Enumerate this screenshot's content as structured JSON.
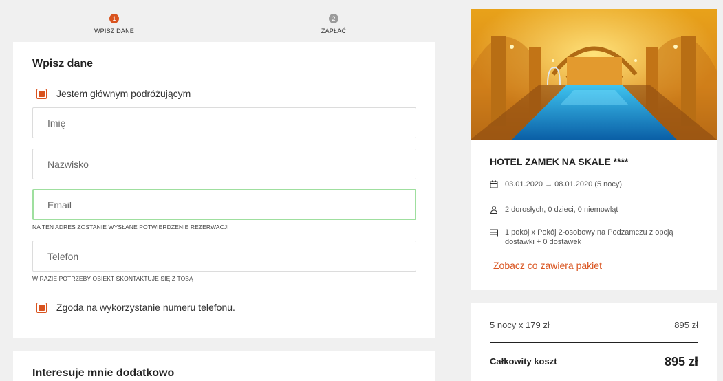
{
  "stepper": {
    "steps": [
      {
        "number": "1",
        "label": "WPISZ DANE",
        "active": true
      },
      {
        "number": "2",
        "label": "ZAPŁAĆ",
        "active": false
      }
    ]
  },
  "form": {
    "title": "Wpisz dane",
    "main_traveler_label": "Jestem głównym podróżującym",
    "main_traveler_checked": true,
    "fields": {
      "first_name": {
        "placeholder": "Imię",
        "value": ""
      },
      "last_name": {
        "placeholder": "Nazwisko",
        "value": ""
      },
      "email": {
        "placeholder": "Email",
        "value": ""
      },
      "phone": {
        "placeholder": "Telefon",
        "value": ""
      }
    },
    "email_hint": "NA TEN ADRES ZOSTANIE WYSŁANE POTWIERDZENIE REZERWACJI",
    "phone_hint": "W RAZIE POTRZEBY OBIEKT SKONTAKTUJE SIĘ Z TOBĄ",
    "consent_label": "Zgoda na wykorzystanie numeru telefonu.",
    "consent_checked": true
  },
  "extra": {
    "title": "Interesuje mnie dodatkowo"
  },
  "hotel": {
    "name": "HOTEL ZAMEK NA SKALE ****",
    "dates": "03.01.2020 → 08.01.2020 (5 nocy)",
    "guests": "2 dorosłych, 0 dzieci, 0 niemowląt",
    "room": "1 pokój x Pokój 2-osobowy na Podzamczu z opcją dostawki + 0 dostawek",
    "package_link": "Zobacz co zawiera pakiet",
    "icons": {
      "dates": "calendar-icon",
      "guests": "person-icon",
      "room": "bed-icon"
    }
  },
  "price": {
    "line_label": "5 nocy x 179 zł",
    "line_value": "895 zł",
    "total_label": "Całkowity koszt",
    "total_value": "895 zł"
  },
  "colors": {
    "accent": "#d9531e",
    "email_focus_border": "#9fdf9f",
    "inactive_step": "#9b9b9b",
    "background": "#f0f0f0"
  }
}
